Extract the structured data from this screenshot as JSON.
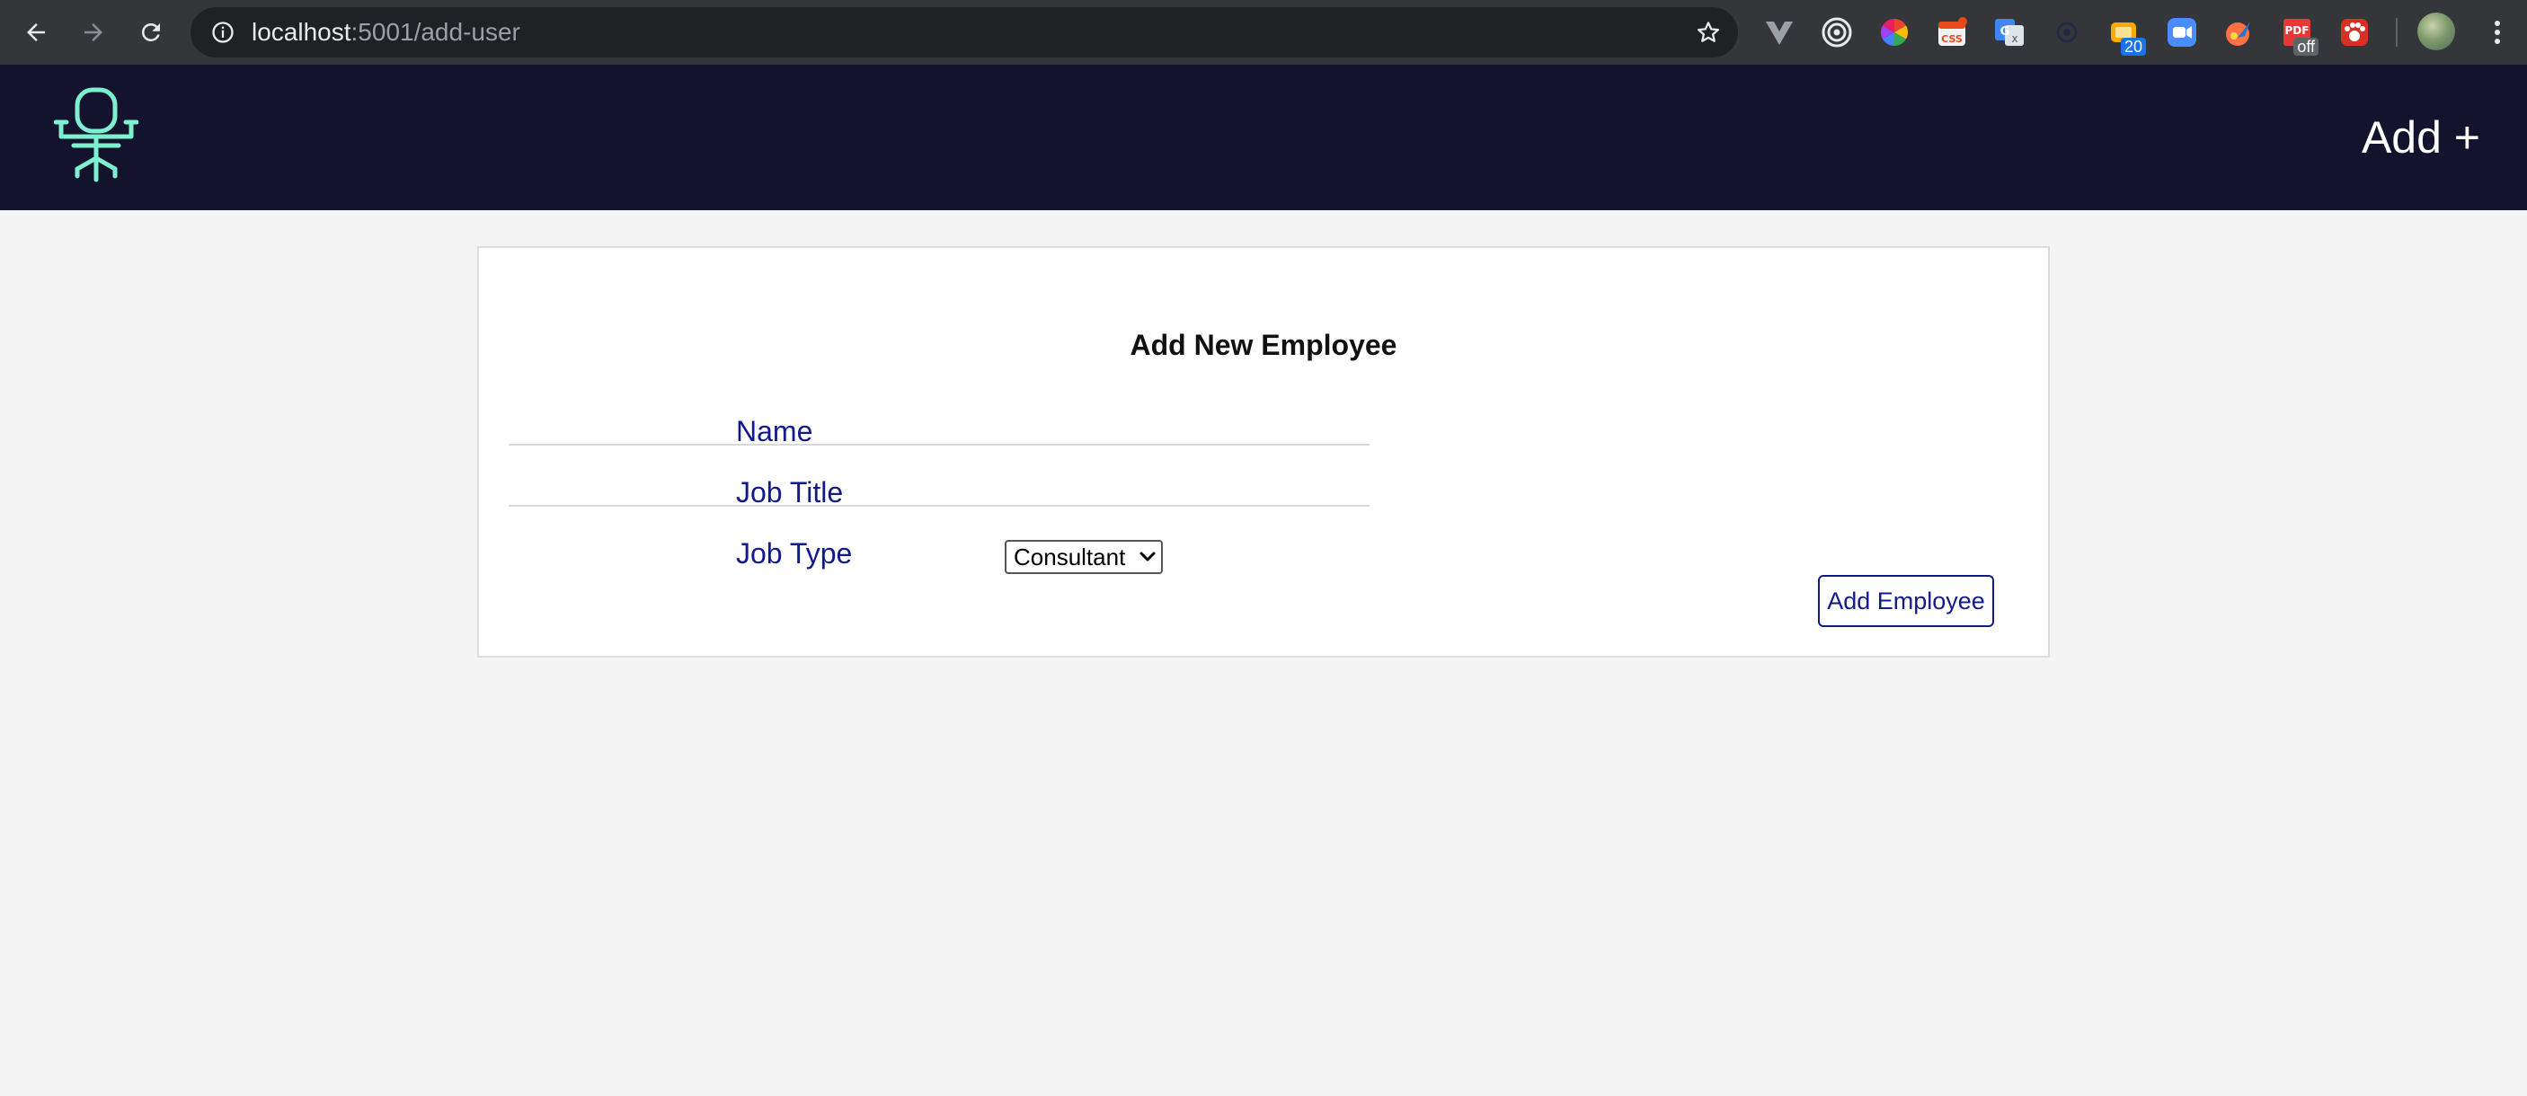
{
  "browser": {
    "url_host": "localhost",
    "url_path": ":5001/add-user",
    "extensions": [
      {
        "name": "vue-devtools-icon",
        "badge": ""
      },
      {
        "name": "target-extension-icon",
        "badge": ""
      },
      {
        "name": "color-wheel-extension-icon",
        "badge": ""
      },
      {
        "name": "css-extension-icon",
        "badge": ""
      },
      {
        "name": "google-translate-icon",
        "badge": ""
      },
      {
        "name": "dark-circle-extension-icon",
        "badge": ""
      },
      {
        "name": "counter-extension-icon",
        "badge": "20"
      },
      {
        "name": "zoom-extension-icon",
        "badge": ""
      },
      {
        "name": "rocket-extension-icon",
        "badge": ""
      },
      {
        "name": "pdf-extension-icon",
        "badge": "off"
      },
      {
        "name": "paw-extension-icon",
        "badge": ""
      }
    ]
  },
  "header": {
    "add_link": "Add +",
    "logo_icon": "office-chair-icon",
    "logo_color": "#7ef0d0",
    "background": "#13132e"
  },
  "form": {
    "title": "Add New Employee",
    "name_label": "Name",
    "name_value": "",
    "job_title_label": "Job Title",
    "job_title_value": "",
    "job_type_label": "Job Type",
    "job_type_selected": "Consultant",
    "submit_label": "Add Employee",
    "accent_color": "#121a8a"
  }
}
